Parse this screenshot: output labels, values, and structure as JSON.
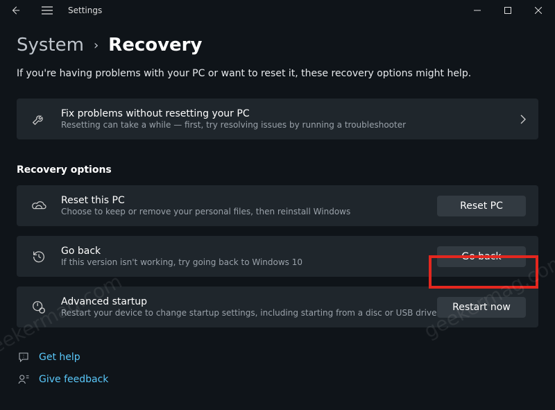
{
  "titlebar": {
    "title": "Settings"
  },
  "breadcrumb": {
    "parent": "System",
    "separator": "›",
    "current": "Recovery"
  },
  "subtitle": "If you're having problems with your PC or want to reset it, these recovery options might help.",
  "fix": {
    "title": "Fix problems without resetting your PC",
    "desc": "Resetting can take a while — first, try resolving issues by running a troubleshooter"
  },
  "section_header": "Recovery options",
  "options": [
    {
      "title": "Reset this PC",
      "desc": "Choose to keep or remove your personal files, then reinstall Windows",
      "button": "Reset PC"
    },
    {
      "title": "Go back",
      "desc": "If this version isn't working, try going back to Windows 10",
      "button": "Go back"
    },
    {
      "title": "Advanced startup",
      "desc": "Restart your device to change startup settings, including starting from a disc or USB drive",
      "button": "Restart now"
    }
  ],
  "links": {
    "help": "Get help",
    "feedback": "Give feedback"
  },
  "watermark": "geekermag.com"
}
